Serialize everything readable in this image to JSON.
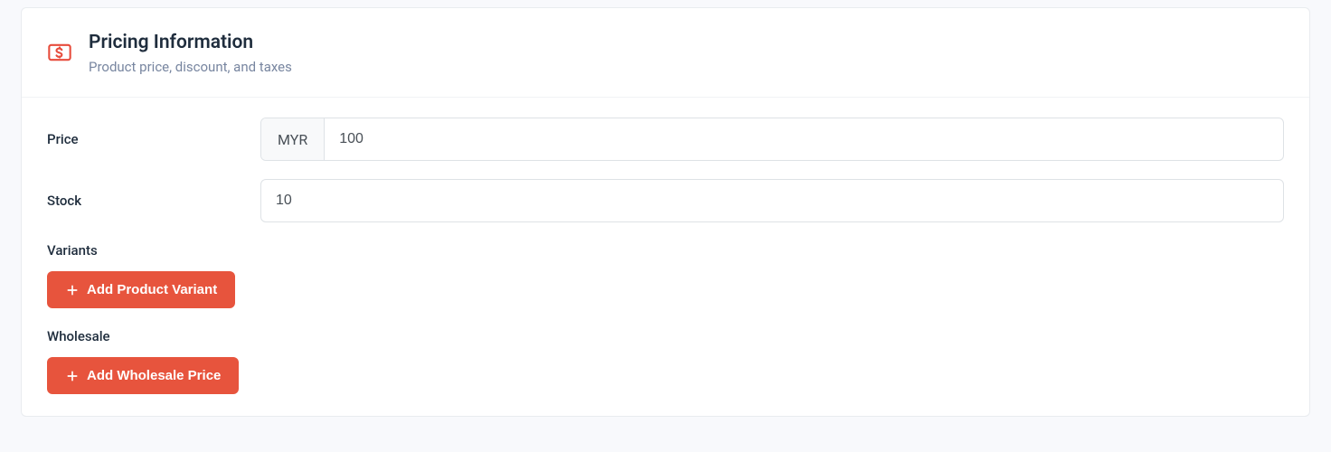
{
  "header": {
    "title": "Pricing Information",
    "subtitle": "Product price, discount, and taxes"
  },
  "form": {
    "price": {
      "label": "Price",
      "currency": "MYR",
      "value": "100"
    },
    "stock": {
      "label": "Stock",
      "value": "10"
    },
    "variants": {
      "label": "Variants",
      "button": "Add Product Variant"
    },
    "wholesale": {
      "label": "Wholesale",
      "button": "Add Wholesale Price"
    }
  }
}
